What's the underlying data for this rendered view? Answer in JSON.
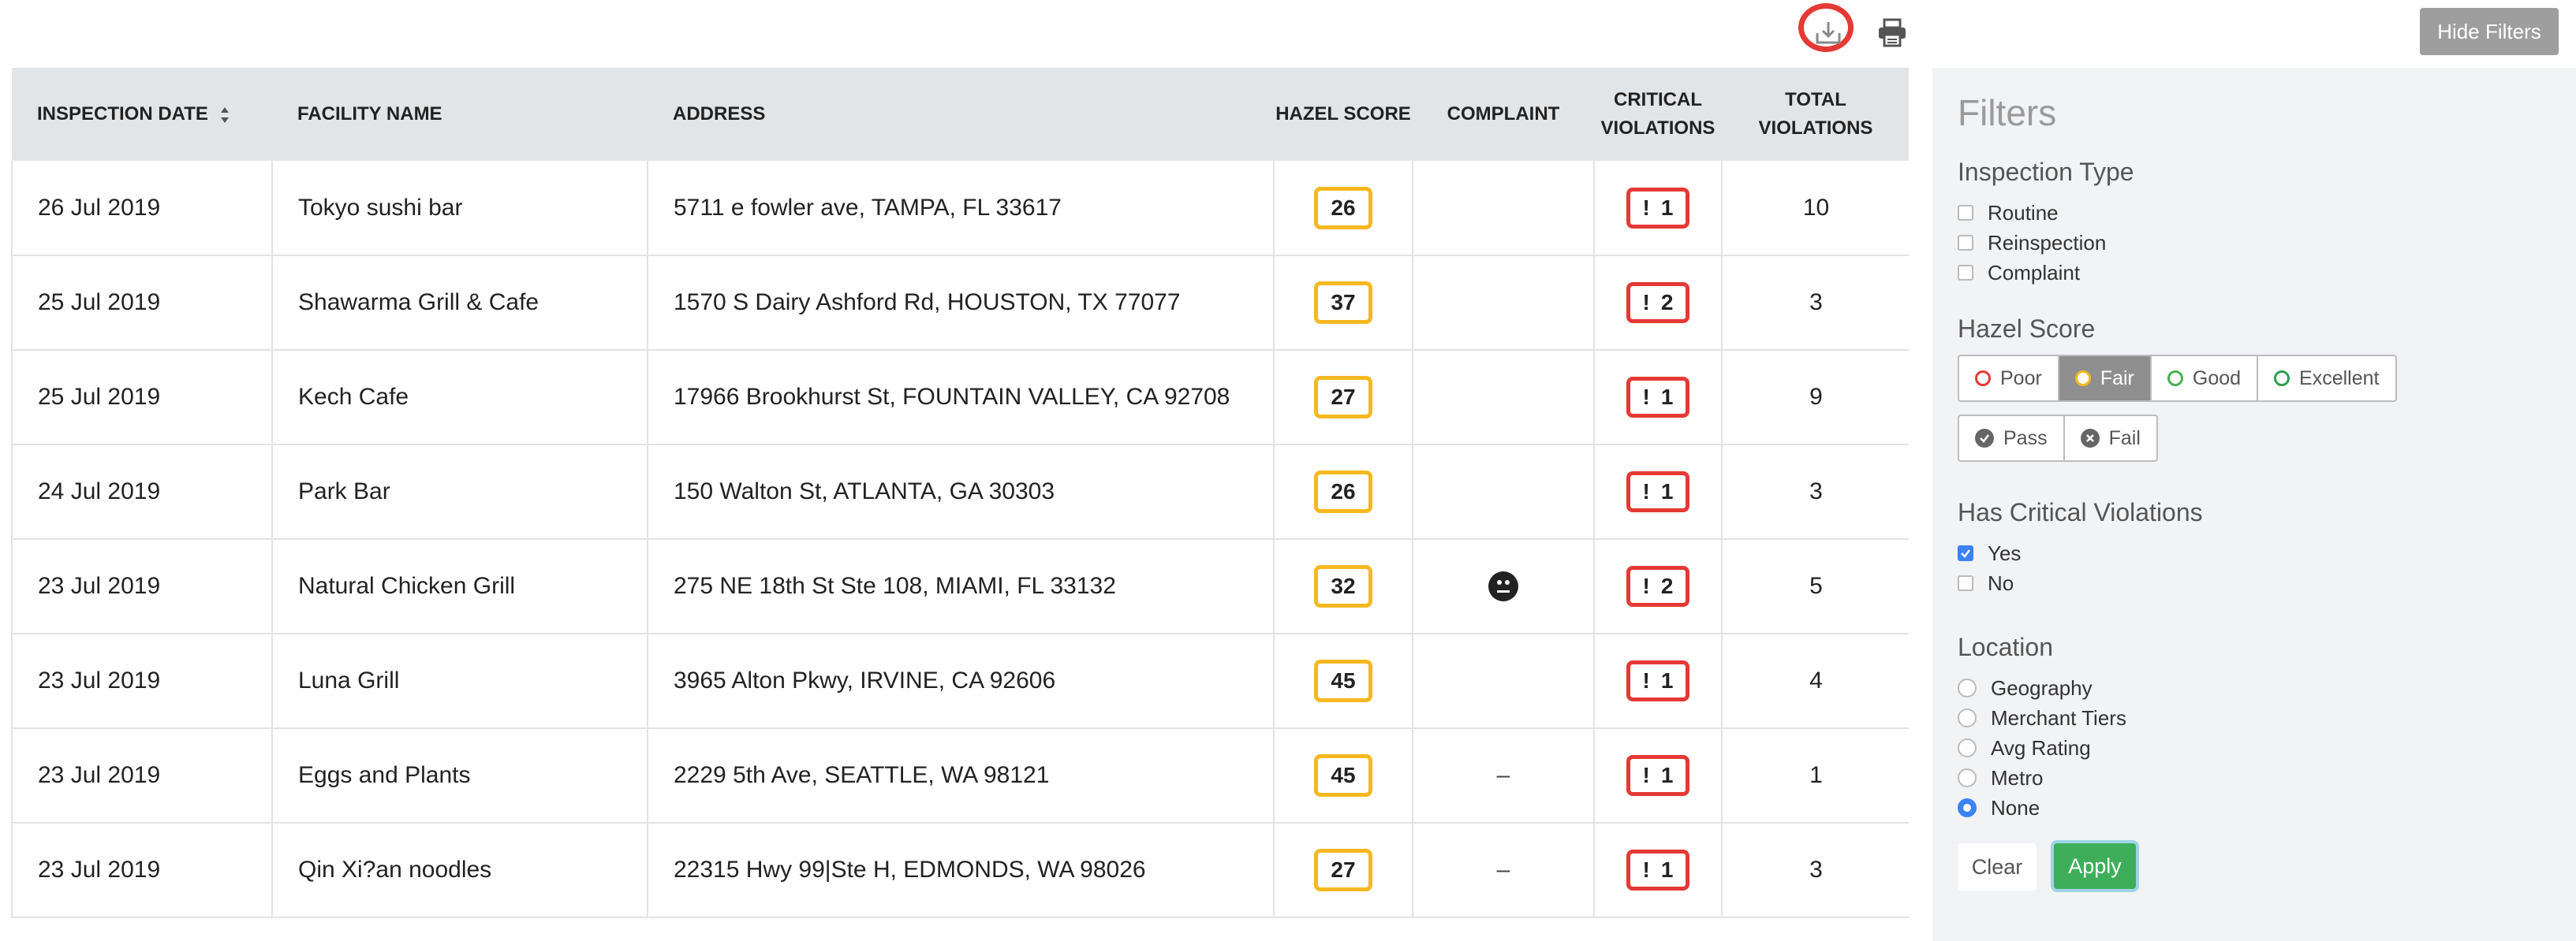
{
  "toolbar": {
    "download_icon": "download-icon",
    "print_icon": "printer-icon",
    "hide_filters_label": "Hide Filters"
  },
  "table": {
    "headers": {
      "inspection_date": "INSPECTION DATE",
      "facility_name": "FACILITY NAME",
      "address": "ADDRESS",
      "hazel_score": "HAZEL SCORE",
      "complaint": "COMPLAINT",
      "critical_violations_1": "CRITICAL",
      "critical_violations_2": "VIOLATIONS",
      "total_violations_1": "TOTAL",
      "total_violations_2": "VIOLATIONS"
    },
    "rows": [
      {
        "date": "26 Jul 2019",
        "facility": "Tokyo sushi bar",
        "address": "5711 e fowler ave, TAMPA, FL 33617",
        "score": "26",
        "complaint": "",
        "critical_mark": "!",
        "critical": "1",
        "total": "10"
      },
      {
        "date": "25 Jul 2019",
        "facility": "Shawarma Grill & Cafe",
        "address": "1570 S Dairy Ashford Rd, HOUSTON, TX 77077",
        "score": "37",
        "complaint": "",
        "critical_mark": "!",
        "critical": "2",
        "total": "3"
      },
      {
        "date": "25 Jul 2019",
        "facility": "Kech Cafe",
        "address": "17966 Brookhurst St, FOUNTAIN VALLEY, CA 92708",
        "score": "27",
        "complaint": "",
        "critical_mark": "!",
        "critical": "1",
        "total": "9"
      },
      {
        "date": "24 Jul 2019",
        "facility": "Park Bar",
        "address": "150 Walton St, ATLANTA, GA 30303",
        "score": "26",
        "complaint": "",
        "critical_mark": "!",
        "critical": "1",
        "total": "3"
      },
      {
        "date": "23 Jul 2019",
        "facility": "Natural Chicken Grill",
        "address": "275 NE 18th St Ste 108, MIAMI, FL 33132",
        "score": "32",
        "complaint": "neutral-face-icon",
        "critical_mark": "!",
        "critical": "2",
        "total": "5"
      },
      {
        "date": "23 Jul 2019",
        "facility": "Luna Grill",
        "address": "3965 Alton Pkwy, IRVINE, CA 92606",
        "score": "45",
        "complaint": "",
        "critical_mark": "!",
        "critical": "1",
        "total": "4"
      },
      {
        "date": "23 Jul 2019",
        "facility": "Eggs and Plants",
        "address": "2229 5th Ave, SEATTLE, WA 98121",
        "score": "45",
        "complaint": "–",
        "critical_mark": "!",
        "critical": "1",
        "total": "1"
      },
      {
        "date": "23 Jul 2019",
        "facility": "Qin Xi?an noodles",
        "address": "22315 Hwy 99|Ste H, EDMONDS, WA 98026",
        "score": "27",
        "complaint": "–",
        "critical_mark": "!",
        "critical": "1",
        "total": "3"
      }
    ]
  },
  "filters": {
    "title": "Filters",
    "inspection_type": {
      "title": "Inspection Type",
      "options": [
        {
          "label": "Routine",
          "checked": false
        },
        {
          "label": "Reinspection",
          "checked": false
        },
        {
          "label": "Complaint",
          "checked": false
        }
      ]
    },
    "hazel_score": {
      "title": "Hazel Score",
      "grades": [
        {
          "label": "Poor",
          "color": "#e53935",
          "active": false
        },
        {
          "label": "Fair",
          "color": "#f5b820",
          "active": true
        },
        {
          "label": "Good",
          "color": "#4caf50",
          "active": false
        },
        {
          "label": "Excellent",
          "color": "#2e9e4f",
          "active": false
        }
      ],
      "pass_fail": [
        {
          "label": "Pass",
          "icon": "check-circle-icon"
        },
        {
          "label": "Fail",
          "icon": "x-circle-icon"
        }
      ]
    },
    "critical_violations": {
      "title": "Has Critical Violations",
      "options": [
        {
          "label": "Yes",
          "checked": true
        },
        {
          "label": "No",
          "checked": false
        }
      ]
    },
    "location": {
      "title": "Location",
      "options": [
        {
          "label": "Geography",
          "selected": false
        },
        {
          "label": "Merchant Tiers",
          "selected": false
        },
        {
          "label": "Avg Rating",
          "selected": false
        },
        {
          "label": "Metro",
          "selected": false
        },
        {
          "label": "None",
          "selected": true
        }
      ]
    },
    "clear_label": "Clear",
    "apply_label": "Apply"
  },
  "colors": {
    "score_border": "#f5b820",
    "critical_border": "#e53935",
    "highlight": "#e53935",
    "apply": "#3fae5a",
    "checked": "#3b82f6"
  }
}
